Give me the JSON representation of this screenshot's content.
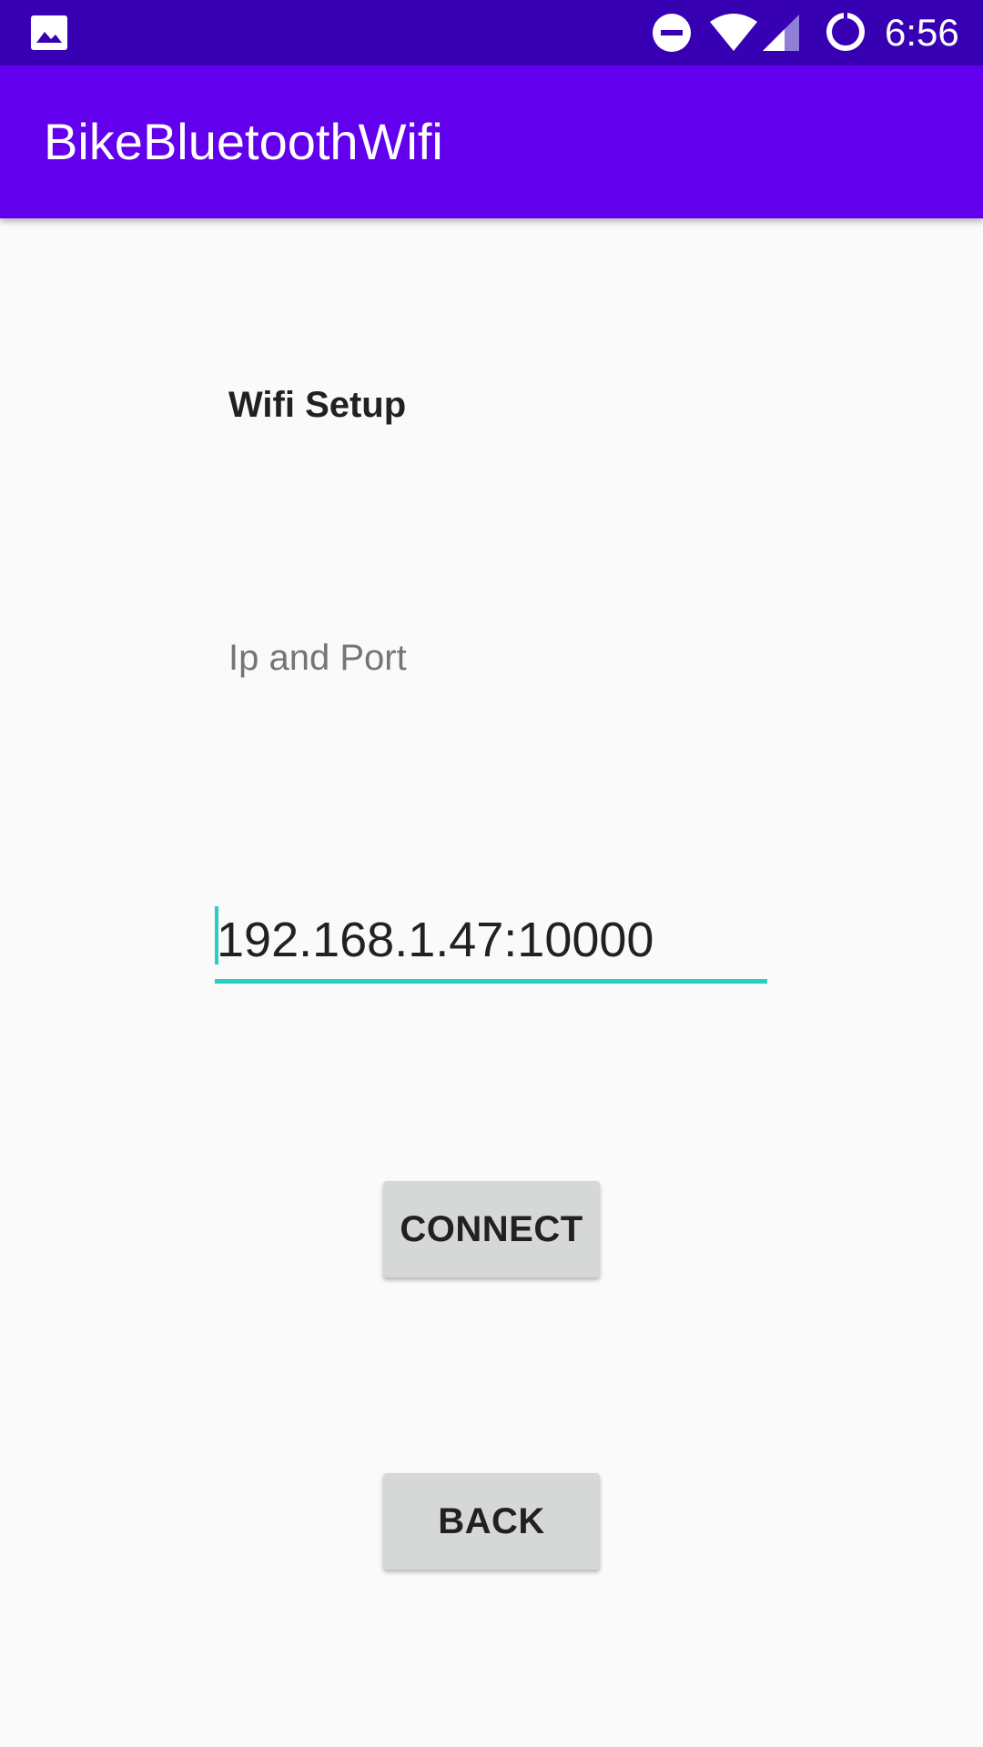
{
  "status_bar": {
    "time": "6:56",
    "icons": [
      "gallery-icon",
      "do-not-disturb-icon",
      "wifi-icon",
      "cell-signal-icon",
      "battery-icon"
    ],
    "background": "#3700b3"
  },
  "app_bar": {
    "title": "BikeBluetoothWifi",
    "background": "#6200ee"
  },
  "main": {
    "heading": "Wifi Setup",
    "ip_label": "Ip and Port",
    "ip_input": {
      "value": "192.168.1.47:10000",
      "focused": true,
      "accent": "#26d0c0"
    },
    "connect_label": "CONNECT",
    "back_label": "BACK"
  }
}
